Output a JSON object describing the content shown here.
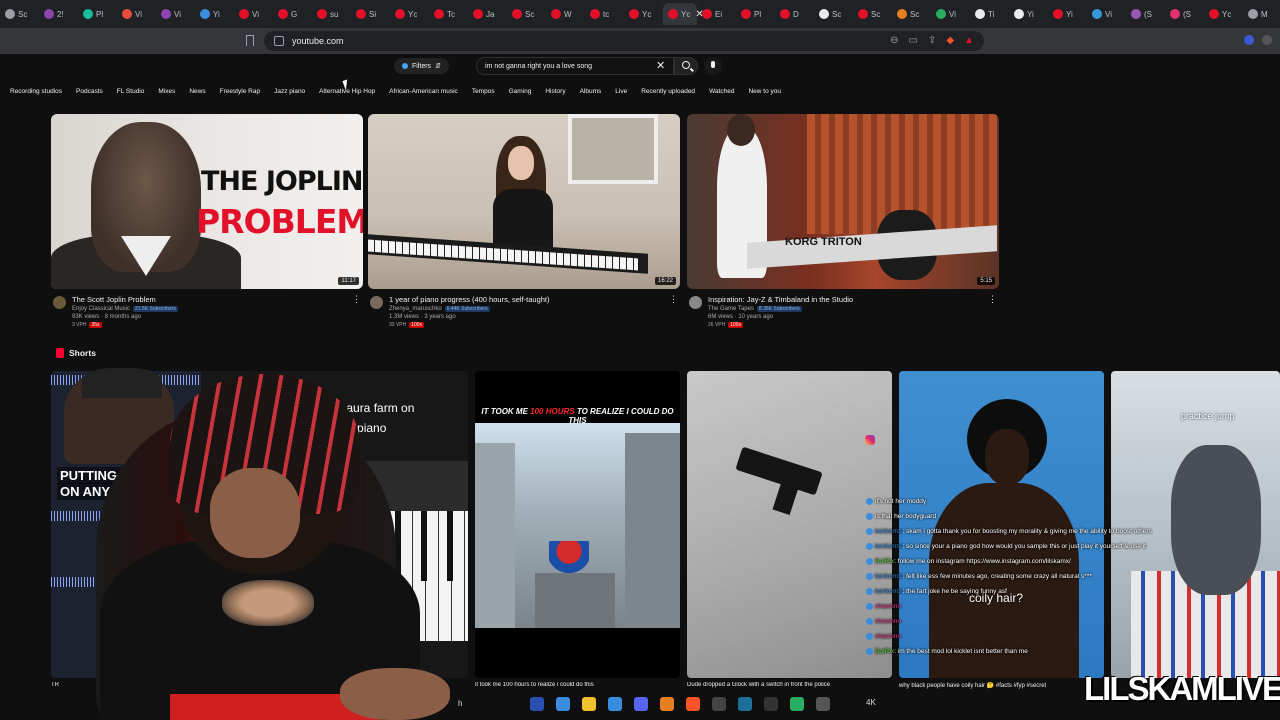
{
  "browser": {
    "tabs": [
      {
        "label": "Sc",
        "color": "#9aa0a6"
      },
      {
        "label": "2!",
        "color": "#8e44ad"
      },
      {
        "label": "Pl",
        "color": "#1abc9c"
      },
      {
        "label": "Vi",
        "color": "#e74c3c"
      },
      {
        "label": "Vi",
        "color": "#8e44ad"
      },
      {
        "label": "Yi",
        "color": "#3a8dde"
      },
      {
        "label": "Vi",
        "color": "#e3102a"
      },
      {
        "label": "G",
        "color": "#e3102a"
      },
      {
        "label": "su",
        "color": "#e3102a"
      },
      {
        "label": "Si",
        "color": "#e3102a"
      },
      {
        "label": "Yc",
        "color": "#e3102a"
      },
      {
        "label": "Tc",
        "color": "#e3102a"
      },
      {
        "label": "Ja",
        "color": "#e3102a"
      },
      {
        "label": "Sc",
        "color": "#e3102a"
      },
      {
        "label": "W",
        "color": "#e3102a"
      },
      {
        "label": "tc",
        "color": "#e3102a"
      },
      {
        "label": "Yc",
        "color": "#e3102a"
      },
      {
        "label": "Yc",
        "color": "#e3102a",
        "active": true
      },
      {
        "label": "Ei",
        "color": "#e3102a"
      },
      {
        "label": "Pl",
        "color": "#e3102a"
      },
      {
        "label": "D",
        "color": "#e3102a"
      },
      {
        "label": "Sc",
        "color": "#e8eaed"
      },
      {
        "label": "Sc",
        "color": "#e3102a"
      },
      {
        "label": "Sc",
        "color": "#e67e22"
      },
      {
        "label": "Vi",
        "color": "#27ae60"
      },
      {
        "label": "Ti",
        "color": "#e8eaed"
      },
      {
        "label": "Yi",
        "color": "#e8eaed"
      },
      {
        "label": "Yi",
        "color": "#e3102a"
      },
      {
        "label": "Vi",
        "color": "#3498db"
      },
      {
        "label": "(S",
        "color": "#9b59b6"
      },
      {
        "label": "(S",
        "color": "#e1306c"
      },
      {
        "label": "Yc",
        "color": "#e3102a"
      },
      {
        "label": "M",
        "color": "#9aa0a6"
      }
    ],
    "url": "youtube.com"
  },
  "youtube": {
    "filters_label": "Filters",
    "search_query": "im not ganna right you a love song",
    "chips": [
      "Recording studios",
      "Podcasts",
      "FL Studio",
      "Mixes",
      "News",
      "Freestyle Rap",
      "Jazz piano",
      "Alternative Hip Hop",
      "African-American music",
      "Tempos",
      "Gaming",
      "History",
      "Albums",
      "Live",
      "Recently uploaded",
      "Watched",
      "New to you"
    ],
    "videos": [
      {
        "title": "The Scott Joplin Problem",
        "channel": "Enjoy Classical Music",
        "subs": "21.5K Subscribers",
        "stats": "93K views · 8 months ago",
        "extra_a": "3 VPH",
        "extra_b": "35x",
        "duration": "11:17",
        "thumb_line1": "THE JOPLIN",
        "thumb_line2": "PROBLEM"
      },
      {
        "title": "1 year of piano progress (400 hours, self-taught)",
        "channel": "Zhenya_maruschko",
        "subs": "6.44K Subscribers",
        "stats": "1.3M views · 3 years ago",
        "extra_a": "33 VPH",
        "extra_b": "100x",
        "duration": "16:22"
      },
      {
        "title": "Inspiration: Jay-Z & Timbaland in the Studio",
        "channel": "The Game Tapes",
        "subs": "8.36K Subscribers",
        "stats": "6M views · 10 years ago",
        "extra_a": "26 VPH",
        "extra_b": "100x",
        "duration": "5:15",
        "thumb_text": "KORG TRITON"
      }
    ],
    "shorts_label": "Shorts",
    "shorts": [
      {
        "caption_a": "w to aura farm on",
        "caption_b": "the piano",
        "overlay": "PUTTING D",
        "overlay2": "ON ANY SA",
        "title": "TR"
      },
      {
        "caption_a": "IT TOOK ME",
        "caption_red": "100 HOURS",
        "caption_b": "TO REALIZE I COULD DO THIS",
        "title": "it took me 100 hours to realize i could do this"
      },
      {
        "title": "Dude dropped a Glock with a switch in front the police"
      },
      {
        "sub": "coily hair?",
        "title": "why black people have coily hair 🤔 #facts #fyp #secret"
      },
      {
        "caption": "practice jump",
        "title": ""
      }
    ]
  },
  "chat": [
    {
      "user": "",
      "msg": "it's not her moddy",
      "color": "blue"
    },
    {
      "user": "",
      "msg": "is that her bodyguard",
      "color": "blue"
    },
    {
      "user": "konkorror",
      "msg": ": skam i gotta thank you for boosting my morality & giving me the ability to boost others",
      "color": "blue"
    },
    {
      "user": "konkorror",
      "msg": ": so since your a piano god how would you sample this or just play it yourself & use it",
      "color": "blue"
    },
    {
      "user": "BotRix",
      "msg": ": follow me on instagram https://www.instagram.com/lilskamx/",
      "color": "green"
    },
    {
      "user": "konkorror",
      "msg": ": felt like ess few minutes ago, creating some crazy all natural s***",
      "color": "blue"
    },
    {
      "user": "konkorror",
      "msg": ": the fart joke he be saying funny asf",
      "color": "blue"
    },
    {
      "user": "shawnnn",
      "msg": "",
      "color": "pink"
    },
    {
      "user": "shawnnn",
      "msg": "",
      "color": "pink"
    },
    {
      "user": "shawnnn",
      "msg": "",
      "color": "pink"
    },
    {
      "user": "BotRix",
      "msg": ": im the best mod lol kicklet isnt better than me",
      "color": "green"
    }
  ],
  "taskbar": [
    {
      "name": "flag-icon",
      "color": "#2b4fb0"
    },
    {
      "name": "copilot-icon",
      "color": "#3a8dde"
    },
    {
      "name": "folder-icon",
      "color": "#f2c12e"
    },
    {
      "name": "store-icon",
      "color": "#3a8dde"
    },
    {
      "name": "discord-icon",
      "color": "#5865f2"
    },
    {
      "name": "shield-icon",
      "color": "#e67e22"
    },
    {
      "name": "brave-icon",
      "color": "#fb542b"
    },
    {
      "name": "obs-icon",
      "color": "#444"
    },
    {
      "name": "steam-icon",
      "color": "#1b6f9a"
    },
    {
      "name": "app-icon",
      "color": "#333"
    },
    {
      "name": "chrome-icon",
      "color": "#27ae60"
    },
    {
      "name": "screen-icon",
      "color": "#555"
    }
  ],
  "taskbar_label": "4K",
  "taskbar_search": "h",
  "watermark": "LILSKAMLIVE"
}
